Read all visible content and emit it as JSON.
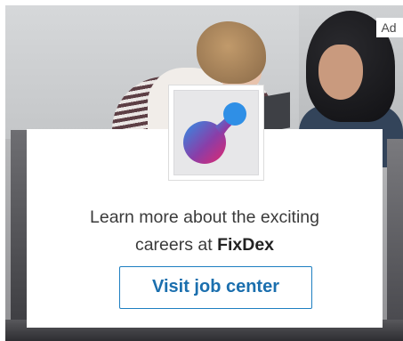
{
  "ad": {
    "badge_label": "Ad",
    "headline_prefix": "Learn more about the exciting",
    "headline_line2": "careers at ",
    "brand_name": "FixDex",
    "cta_label": "Visit job center"
  },
  "colors": {
    "accent": "#1e7fc1",
    "logo_blue": "#2f8fe6",
    "logo_pink": "#e2276e"
  },
  "icons": {
    "brand_logo": "fixdex-logo-icon"
  }
}
